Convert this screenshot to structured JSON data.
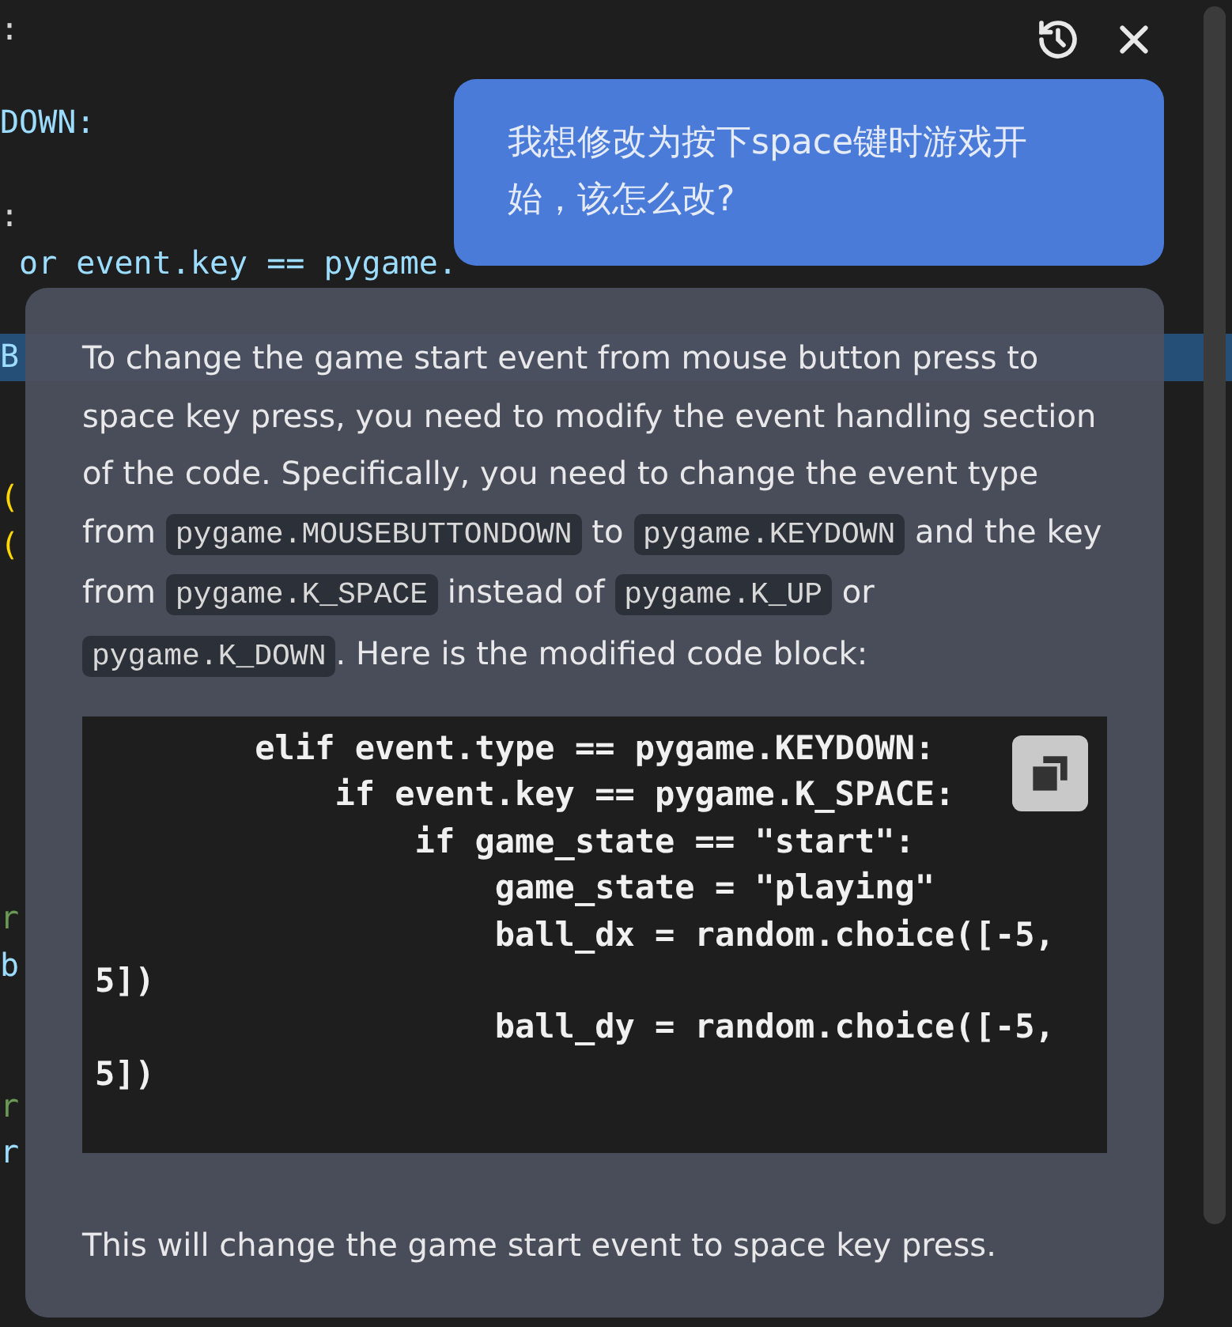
{
  "editor": {
    "lines": [
      {
        "kind": "code",
        "text": ":",
        "color": "#d4d4d4"
      },
      {
        "kind": "blank"
      },
      {
        "kind": "code",
        "text": "DOWN:",
        "color": "#9cdcfe"
      },
      {
        "kind": "blank"
      },
      {
        "kind": "code",
        "text": ":",
        "color": "#d4d4d4"
      },
      {
        "kind": "code",
        "text": " or event.key == pygame.",
        "color": "#9cdcfe"
      },
      {
        "kind": "blank"
      },
      {
        "kind": "highlighted",
        "text": "B",
        "color": "#9cdcfe"
      },
      {
        "kind": "blank"
      },
      {
        "kind": "blank"
      },
      {
        "kind": "code",
        "text": "(",
        "color": "#ffd700"
      },
      {
        "kind": "code",
        "text": "(",
        "color": "#ffd700"
      },
      {
        "kind": "blank"
      },
      {
        "kind": "blank"
      },
      {
        "kind": "blank"
      },
      {
        "kind": "blank"
      },
      {
        "kind": "blank"
      },
      {
        "kind": "blank"
      },
      {
        "kind": "blank"
      },
      {
        "kind": "code",
        "text": "r",
        "color": "#6a9955"
      },
      {
        "kind": "code",
        "text": "b",
        "color": "#9cdcfe"
      },
      {
        "kind": "blank"
      },
      {
        "kind": "blank"
      },
      {
        "kind": "code",
        "text": "r",
        "color": "#6a9955"
      },
      {
        "kind": "code",
        "text": "r",
        "color": "#9cdcfe"
      }
    ]
  },
  "chat": {
    "header_buttons": [
      {
        "kind": "history"
      },
      {
        "kind": "close"
      }
    ],
    "question": "我想修改为按下space键时游戏开始，该怎么改?",
    "answer": {
      "paragraph": [
        {
          "kind": "text",
          "text": "To change the game start event from mouse button press to space key press, you need to modify the event handling section of the code. Specifically, you need to change the event type from "
        },
        {
          "kind": "code",
          "text": "pygame.MOUSEBUTTONDOWN"
        },
        {
          "kind": "text",
          "text": " to "
        },
        {
          "kind": "code",
          "text": "pygame.KEYDOWN"
        },
        {
          "kind": "text",
          "text": " and the key from "
        },
        {
          "kind": "code",
          "text": "pygame.K_SPACE"
        },
        {
          "kind": "text",
          "text": " instead of "
        },
        {
          "kind": "code",
          "text": "pygame.K_UP"
        },
        {
          "kind": "text",
          "text": " or "
        },
        {
          "kind": "code",
          "text": "pygame.K_DOWN"
        },
        {
          "kind": "text",
          "text": ". Here is the modified code block:"
        }
      ],
      "code_block": [
        "        elif event.type == pygame.KEYDOWN:",
        "            if event.key == pygame.K_SPACE:",
        "                if game_state == \"start\":",
        "                    game_state = \"playing\"",
        "                    ball_dx = random.choice([-5, 5])",
        "                    ball_dy = random.choice([-5, 5])"
      ],
      "closing": "This will change the game start event to space key press."
    }
  }
}
